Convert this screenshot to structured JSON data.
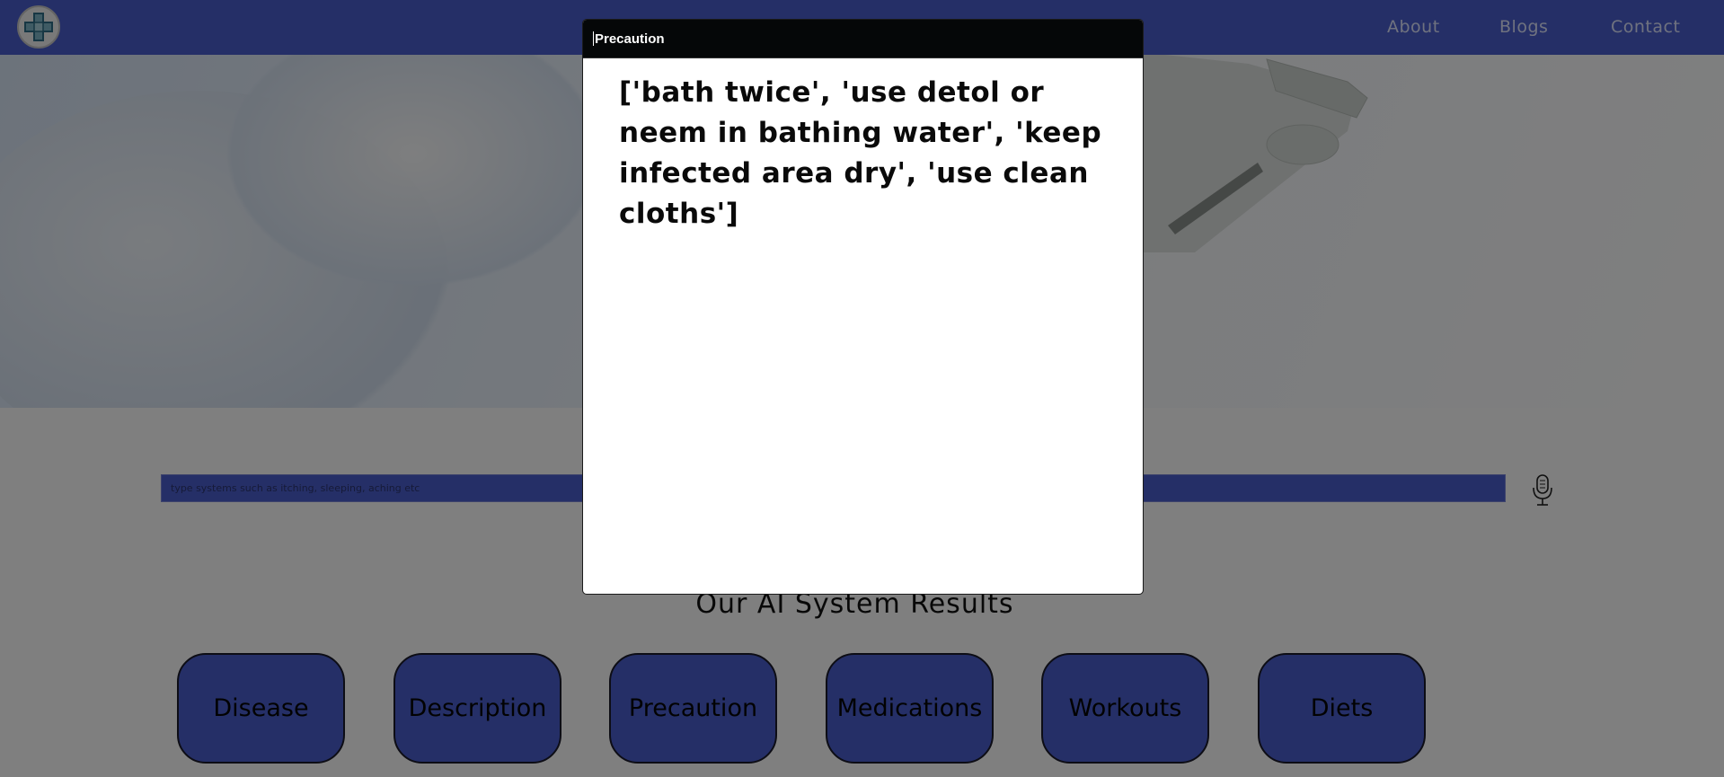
{
  "navbar": {
    "links": [
      "About",
      "Blogs",
      "Contact"
    ],
    "bg_color": "#4a5fcf"
  },
  "search": {
    "placeholder": "type systems such as itching, sleeping, aching etc"
  },
  "results": {
    "title": "Our AI System Results",
    "buttons": [
      "Disease",
      "Description",
      "Precaution",
      "Medications",
      "Workouts",
      "Diets"
    ]
  },
  "modal": {
    "title": "Precaution",
    "body": "['bath twice', 'use detol or neem in bathing water', 'keep infected area dry', 'use clean cloths']",
    "header_color": "#050708"
  },
  "icons": [
    "medical-cross-logo-icon",
    "microphone-icon"
  ]
}
